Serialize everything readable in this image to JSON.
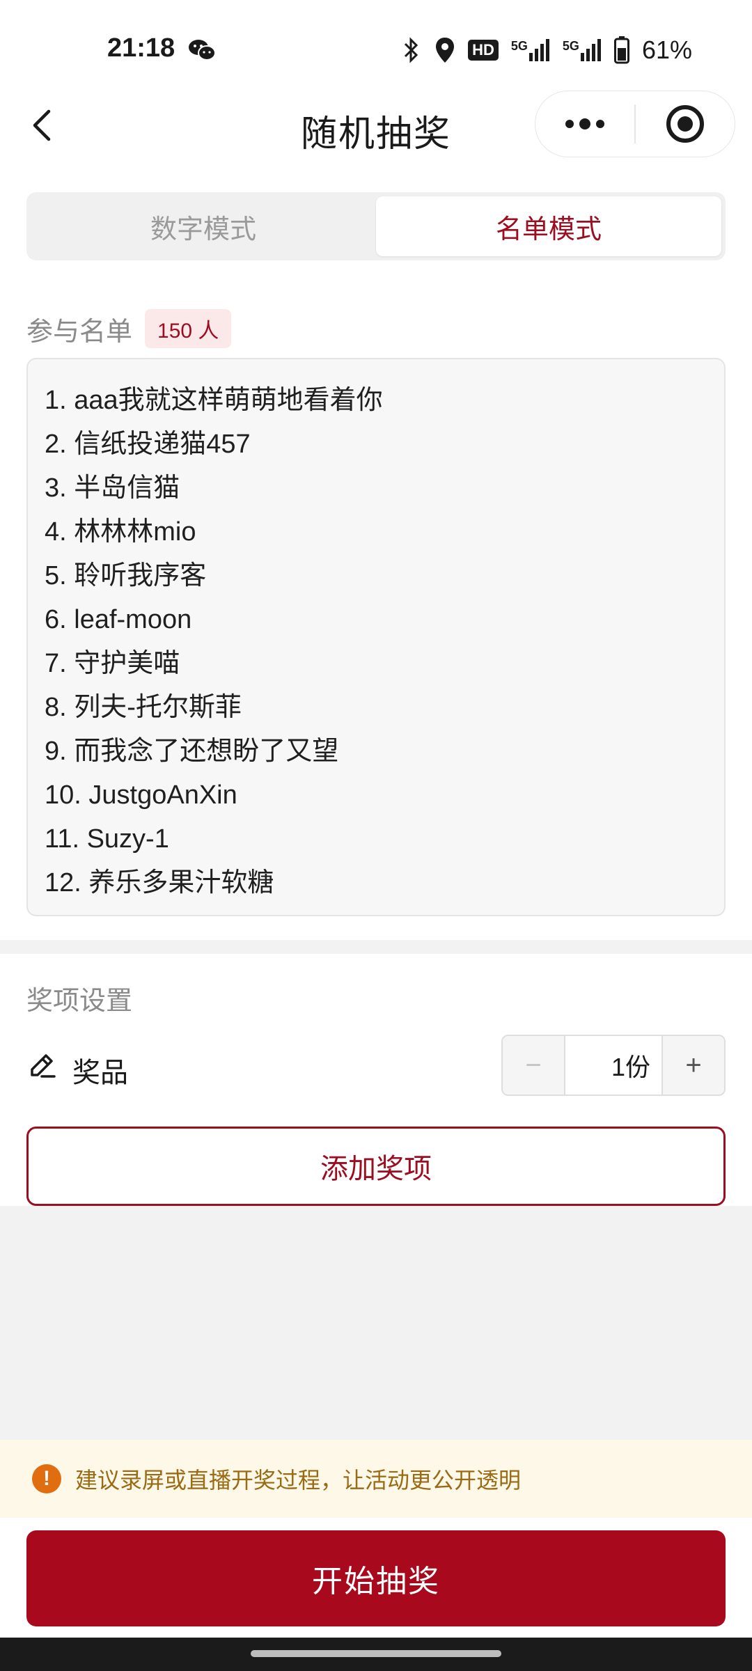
{
  "status_bar": {
    "time": "21:18",
    "battery": "61%",
    "hd_label": "HD",
    "network_1": "5G",
    "network_2": "5G",
    "icons": [
      "wechat-icon",
      "bluetooth-icon",
      "location-icon",
      "hd-icon",
      "signal-icon",
      "signal-icon",
      "battery-icon"
    ]
  },
  "nav": {
    "title": "随机抽奖",
    "icons": [
      "back-icon",
      "more-icon",
      "target-icon"
    ]
  },
  "mode_tabs": [
    {
      "label": "数字模式",
      "active": false
    },
    {
      "label": "名单模式",
      "active": true
    }
  ],
  "participants": {
    "label": "参与名单",
    "count": "150 人",
    "names": [
      "1. aaa我就这样萌萌地看着你",
      "2. 信纸投递猫457",
      "3. 半岛信猫",
      "4. 林林林mio",
      "5. 聆听我序客",
      "6. leaf-moon",
      "7. 守护美喵",
      "8. 列夫-托尔斯菲",
      "9. 而我念了还想盼了又望",
      "10. JustgoAnXin",
      "11. Suzy-1",
      "12. 养乐多果汁软糖"
    ]
  },
  "prize_settings": {
    "title": "奖项设置",
    "prize_name": "奖品",
    "minus": "−",
    "quantity": "1份",
    "plus": "+",
    "add_button": "添加奖项"
  },
  "notice": {
    "icon_text": "!",
    "text": "建议录屏或直播开奖过程，让活动更公开透明"
  },
  "start_button": "开始抽奖",
  "colors": {
    "accent": "#9b0d1f",
    "start_button": "#a8091c",
    "notice_bg": "#fdf8e8",
    "notice_icon": "#e06d0f"
  }
}
